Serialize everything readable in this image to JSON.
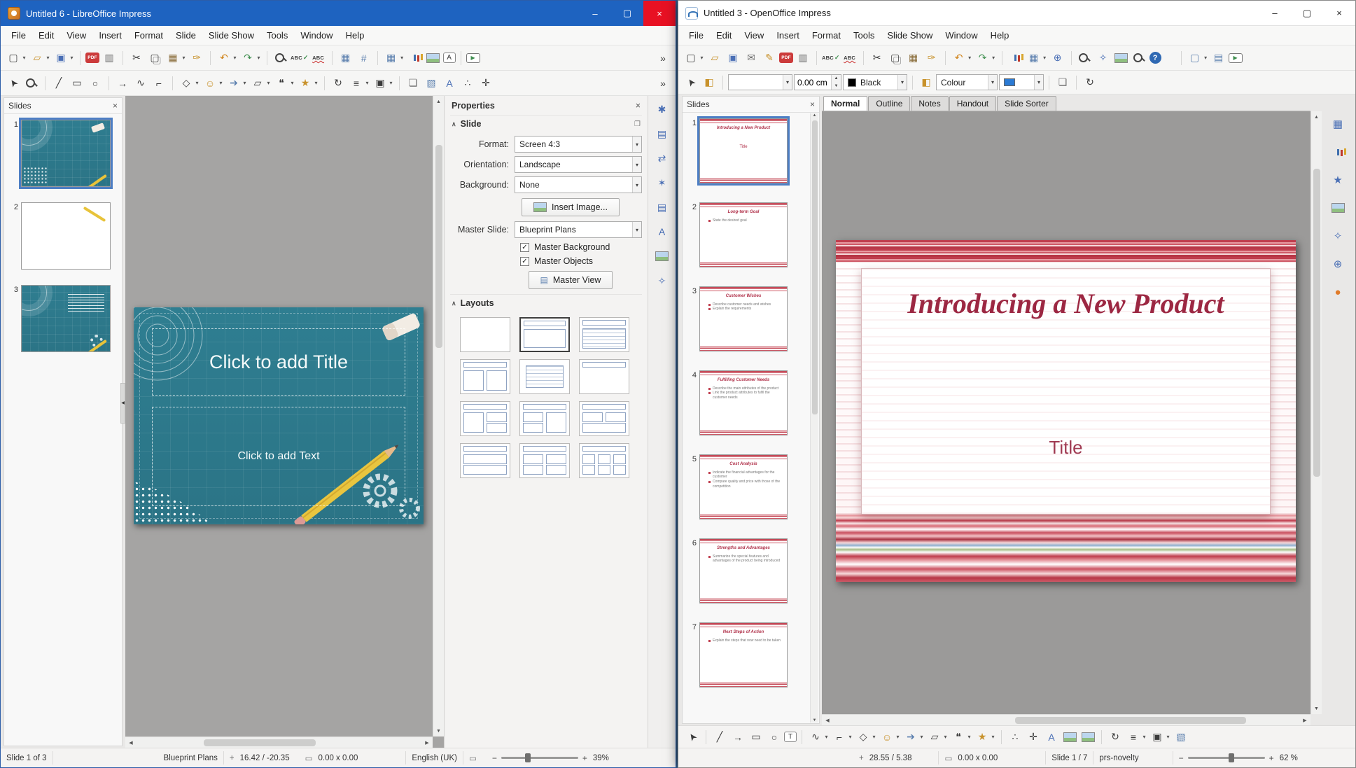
{
  "icons": {
    "new": "▢",
    "open": "▱",
    "save": "▣",
    "pdf": "PDF",
    "print": "▥",
    "cut": "✂",
    "copy": "▢",
    "paste": "▦",
    "brush": "✑",
    "undo": "↶",
    "redo": "↷",
    "spell": "ABC",
    "grid": "▦",
    "snaplines": "#",
    "table": "▦",
    "textbox": "A",
    "media": "▶",
    "select": "➤",
    "line": "╱",
    "rect": "▭",
    "ellipse": "○",
    "arrowline": "→",
    "curve": "∿",
    "connector": "⌐",
    "basic_shapes": "◇",
    "smiley": "☺",
    "block_arrow": "➔",
    "flowchart": "▱",
    "callout": "❝",
    "star": "★",
    "rotate": "↻",
    "align": "≡",
    "arrange": "▣",
    "shadow": "❏",
    "three_d": "▧",
    "fontwork": "A",
    "points": "∴",
    "glue": "✛",
    "email": "✉",
    "edit": "✎",
    "hyperlink": "⊕",
    "navigator": "✧",
    "help": "?",
    "paintcan": "◧",
    "text_t": "T",
    "settings": "✱",
    "transition": "⇄",
    "animation": "✶",
    "master_slides": "▤",
    "styles": "A",
    "dot": "●",
    "dropdown": "▾",
    "overflow": "»",
    "close": "×",
    "collapse": "∧",
    "undock": "❐",
    "check": "✓",
    "up": "▲",
    "down": "▼",
    "left": "◀",
    "right": "▶",
    "min": "–",
    "max": "▢",
    "zoom_out": "−",
    "zoom_in": "+",
    "pos_marker": "+",
    "size_marker": "▭"
  },
  "lw": {
    "title": "Untitled 6 - LibreOffice Impress",
    "menu": [
      "File",
      "Edit",
      "View",
      "Insert",
      "Format",
      "Slide",
      "Slide Show",
      "Tools",
      "Window",
      "Help"
    ],
    "slides_panel": {
      "title": "Slides"
    },
    "slide_numbers": [
      "1",
      "2",
      "3"
    ],
    "canvas": {
      "title_placeholder": "Click to add Title",
      "text_placeholder": "Click to add Text"
    },
    "props": {
      "title": "Properties",
      "slide_section": "Slide",
      "format_label": "Format:",
      "format_value": "Screen 4:3",
      "orientation_label": "Orientation:",
      "orientation_value": "Landscape",
      "background_label": "Background:",
      "background_value": "None",
      "insert_image": "Insert Image...",
      "master_label": "Master Slide:",
      "master_value": "Blueprint Plans",
      "cb_master_bg": "Master Background",
      "cb_master_obj": "Master Objects",
      "master_view": "Master View",
      "layouts_title": "Layouts"
    },
    "status": {
      "slide": "Slide 1 of 3",
      "master": "Blueprint Plans",
      "pos": "16.42 / -20.35",
      "size": "0.00 x 0.00",
      "lang": "English (UK)",
      "zoom": "39%"
    }
  },
  "rw": {
    "title": "Untitled 3 - OpenOffice Impress",
    "menu": [
      "File",
      "Edit",
      "View",
      "Insert",
      "Format",
      "Tools",
      "Slide Show",
      "Window",
      "Help"
    ],
    "slides_panel": {
      "title": "Slides"
    },
    "tabs": [
      "Normal",
      "Outline",
      "Notes",
      "Handout",
      "Slide Sorter"
    ],
    "slides": [
      {
        "num": "1",
        "title": "Introducing a New Product",
        "b1": "Title",
        "b2": ""
      },
      {
        "num": "2",
        "title": "Long-term Goal",
        "b1": "State the desired goal",
        "b2": ""
      },
      {
        "num": "3",
        "title": "Customer Wishes",
        "b1": "Describe customer needs and wishes",
        "b2": "Explain the requirements"
      },
      {
        "num": "4",
        "title": "Fulfilling Customer Needs",
        "b1": "Describe the main attributes of the product",
        "b2": "Link the product attributes to fulfil the customer needs"
      },
      {
        "num": "5",
        "title": "Cost Analysis",
        "b1": "Indicate the financial advantages for the customer",
        "b2": "Compare quality and price with those of the competition"
      },
      {
        "num": "6",
        "title": "Strengths and Advantages",
        "b1": "Summarize the special features and advantages of the product being introduced",
        "b2": ""
      },
      {
        "num": "7",
        "title": "Next Steps of Action",
        "b1": "Explain the steps that now need to be taken",
        "b2": ""
      }
    ],
    "main_slide": {
      "title": "Introducing a New Product",
      "body": "Title"
    },
    "linebar": {
      "width_value": "0.00 cm",
      "line_color": "Black",
      "fill_type": "Colour"
    },
    "status": {
      "pos": "28.55 / 5.38",
      "size": "0.00 x 0.00",
      "slide": "Slide 1 / 7",
      "master": "prs-novelty",
      "zoom": "62 %"
    }
  }
}
